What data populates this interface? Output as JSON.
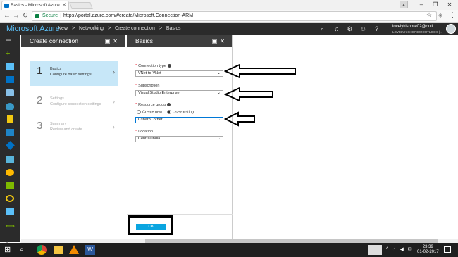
{
  "browser": {
    "tab_title": "Basics - Microsoft Azure",
    "secure_label": "Secure",
    "url": "https://portal.azure.com/#create/Microsoft.Connection-ARM"
  },
  "azure": {
    "brand": "Microsoft Azure",
    "breadcrumbs": [
      "New",
      ">",
      "Networking",
      ">",
      "Create connection",
      ">",
      "Basics"
    ],
    "account_name": "lovelykishore02@outl...",
    "account_sub": "LOVELYKISHORE02OUTLOOK (..."
  },
  "create_blade": {
    "title": "Create connection",
    "steps": [
      {
        "num": "1",
        "title": "Basics",
        "subtitle": "Configure basic settings"
      },
      {
        "num": "2",
        "title": "Settings",
        "subtitle": "Configure connection settings"
      },
      {
        "num": "3",
        "title": "Summary",
        "subtitle": "Review and create"
      }
    ]
  },
  "basics_blade": {
    "title": "Basics",
    "connection_type_label": "Connection type",
    "connection_type_value": "VNet-to-VNet",
    "subscription_label": "Subscription",
    "subscription_value": "Visual Studio Enterprise",
    "resource_group_label": "Resource group",
    "radio_create_new": "Create new",
    "radio_use_existing": "Use existing",
    "resource_group_value": "CsharpCorner",
    "location_label": "Location",
    "location_value": "Central India",
    "ok_label": "OK"
  },
  "taskbar": {
    "time": "23:39",
    "date": "01-02-2017"
  },
  "colors": {
    "azure_header": "#2b2b2b",
    "brand_blue": "#5bc0f8",
    "active_step": "#c7e7f8",
    "ok_button": "#0aa5e0"
  }
}
